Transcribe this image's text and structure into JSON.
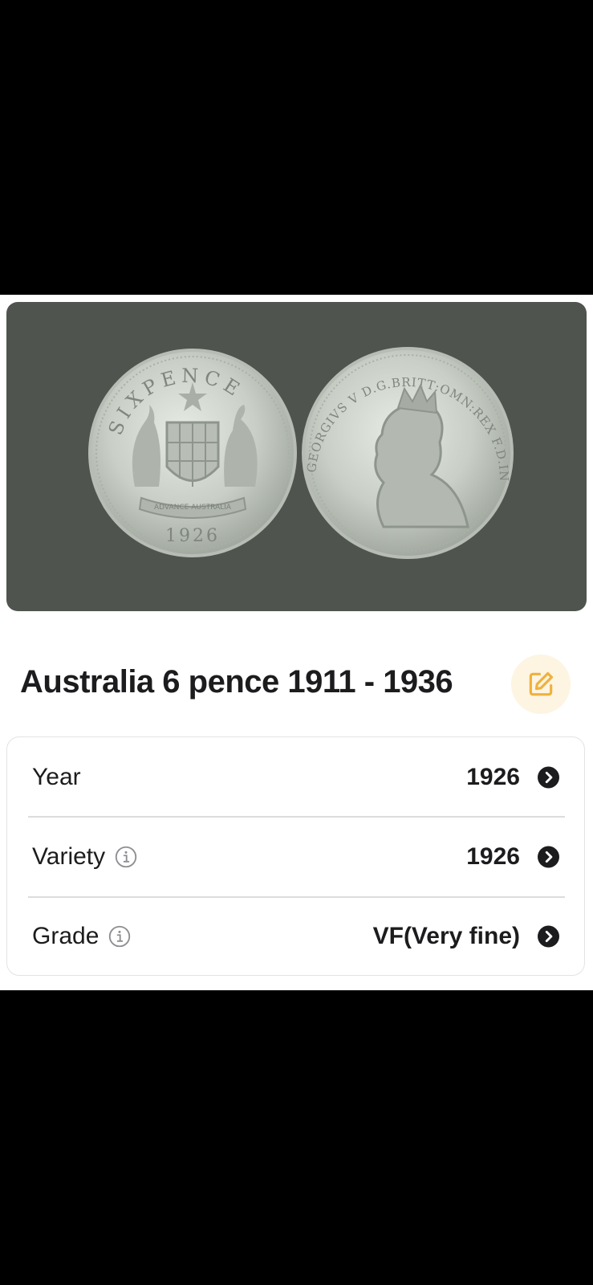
{
  "coin": {
    "title": "Australia 6 pence 1911 - 1936",
    "photo": {
      "reverse_legend": "SIXPENCE",
      "reverse_year": "1926",
      "reverse_motto": "ADVANCE AUSTRALIA",
      "obverse_legend": "GEORGIVS V D.G.BRITT:OMN:REX F.D.IND:IMP:"
    }
  },
  "details": {
    "rows": [
      {
        "label": "Year",
        "value": "1926",
        "has_info": false
      },
      {
        "label": "Variety",
        "value": "1926",
        "has_info": true
      },
      {
        "label": "Grade",
        "value": "VF(Very fine)",
        "has_info": true
      }
    ]
  },
  "icons": {
    "edit": "edit-icon",
    "info": "info-icon",
    "chevron": "chevron-right-circle-icon"
  },
  "colors": {
    "photo_background": "#4f554e",
    "edit_accent": "#f0b13b",
    "edit_background": "#fdf4e2",
    "text": "#1c1c1e",
    "divider": "#dcdcdf"
  }
}
